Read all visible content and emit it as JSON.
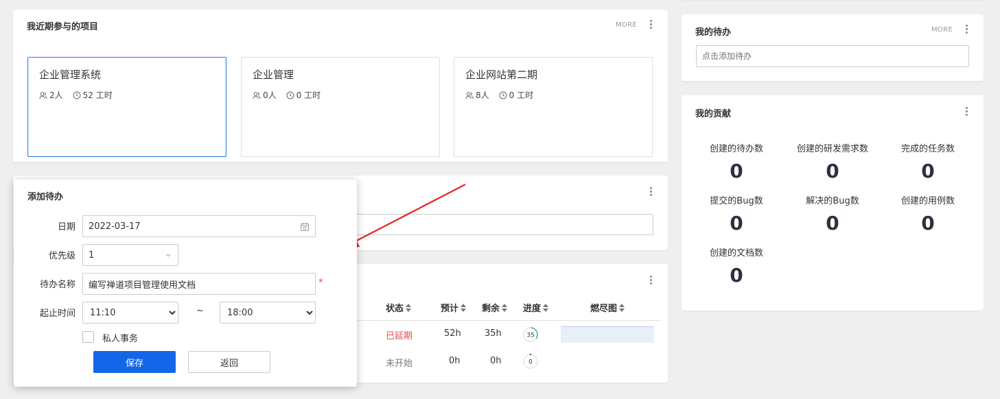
{
  "projects": {
    "title": "我近期参与的项目",
    "more": "MORE",
    "items": [
      {
        "name": "企业管理系统",
        "members": "2人",
        "hours": "52 工时"
      },
      {
        "name": "企业管理",
        "members": "0人",
        "hours": "0 工时"
      },
      {
        "name": "企业网站第二期",
        "members": "8人",
        "hours": "0 工时"
      }
    ]
  },
  "todo": {
    "title": "我的待办",
    "more": "MORE",
    "placeholder": "点击添加待办"
  },
  "tasks": {
    "headers": [
      "状态",
      "预计",
      "剩余",
      "进度",
      "燃尽图"
    ],
    "rows": [
      {
        "status": "已延期",
        "estimate": "52h",
        "left": "35h",
        "progress": "35"
      },
      {
        "status": "未开始",
        "estimate": "0h",
        "left": "0h",
        "progress": "0"
      }
    ],
    "status_colors": {
      "delayed": "#e8484b",
      "pending": "#777777"
    },
    "progress_percent": [
      35,
      0
    ]
  },
  "dialog": {
    "title": "添加待办",
    "date_label": "日期",
    "date_value": "2022-03-17",
    "priority_label": "优先级",
    "priority_value": "1",
    "name_label": "待办名称",
    "name_value": "编写禅道项目管理使用文档",
    "required": "*",
    "time_label": "起止时间",
    "start_time": "11:10",
    "tilde": "~",
    "end_time": "18:00",
    "private_label": "私人事务",
    "save": "保存",
    "back": "返回"
  },
  "contrib": {
    "title": "我的贡献",
    "items": [
      {
        "label": "创建的待办数",
        "value": "0"
      },
      {
        "label": "创建的研发需求数",
        "value": "0"
      },
      {
        "label": "完成的任务数",
        "value": "0"
      },
      {
        "label": "提交的Bug数",
        "value": "0"
      },
      {
        "label": "解决的Bug数",
        "value": "0"
      },
      {
        "label": "创建的用例数",
        "value": "0"
      },
      {
        "label": "创建的文档数",
        "value": "0"
      }
    ]
  },
  "colors": {
    "accent": "#1366e8",
    "active_border": "#2e7fe0",
    "arrow": "#e8231f",
    "required": "#e8484b"
  }
}
